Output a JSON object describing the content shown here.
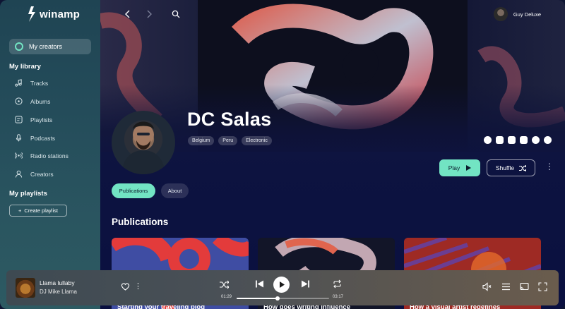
{
  "app": {
    "name": "winamp"
  },
  "sidebar": {
    "my_creators": "My creators",
    "library_title": "My library",
    "library_items": [
      {
        "label": "Tracks",
        "icon": "music-note-icon"
      },
      {
        "label": "Albums",
        "icon": "disc-icon"
      },
      {
        "label": "Playlists",
        "icon": "playlist-icon"
      },
      {
        "label": "Podcasts",
        "icon": "microphone-icon"
      },
      {
        "label": "Radio stations",
        "icon": "radio-icon"
      },
      {
        "label": "Creators",
        "icon": "user-icon"
      }
    ],
    "playlists_title": "My playlists",
    "create_playlist": "Create playlist"
  },
  "header": {
    "user_name": "Guy Deluxe"
  },
  "artist": {
    "name": "DC Salas",
    "tags": [
      "Belgium",
      "Peru",
      "Electronic"
    ],
    "socials": [
      "facebook-icon",
      "instagram-icon",
      "twitter-icon",
      "youtube-icon",
      "spotify-icon",
      "globe-icon"
    ]
  },
  "actions": {
    "play": "Play",
    "shuffle": "Shuffle"
  },
  "tabs": [
    {
      "label": "Publications",
      "active": true
    },
    {
      "label": "About",
      "active": false
    }
  ],
  "publications": {
    "title": "Publications",
    "cards": [
      {
        "title": "Starting your traveling blog"
      },
      {
        "title": "How does writing influence"
      },
      {
        "title": "How a visual artist redefines"
      }
    ]
  },
  "player": {
    "song": "Llama lullaby",
    "artist": "DJ Mike Llama",
    "current_time": "01:29",
    "total_time": "03:17",
    "progress": 0.44
  },
  "colors": {
    "accent": "#72e4c3",
    "background": "#0c1234"
  }
}
